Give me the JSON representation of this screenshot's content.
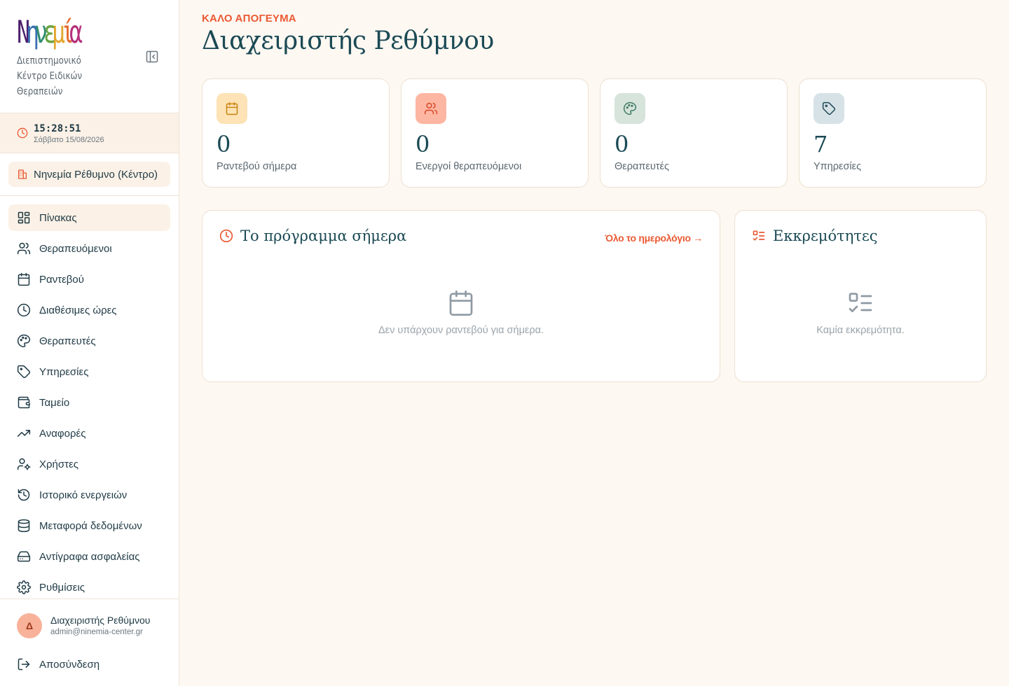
{
  "sidebar": {
    "brand_name": "Νηνεμία",
    "brand_letters": [
      "Ν",
      "η",
      "ν",
      "ε",
      "μ",
      "ί",
      "α"
    ],
    "brand_colors": [
      "#4d1f6d",
      "#3b6fb3",
      "#2f8d6f",
      "#6aa43f",
      "#e3a52b",
      "#e56b2f",
      "#b42f7a"
    ],
    "brand_subtitle": "Διεπιστημονικό Κέντρο Ειδικών Θεραπειών",
    "clock": {
      "time": "15:28:51",
      "date": "Σάββατο 15/08/2026"
    },
    "location": "Νηνεμία Ρέθυμνο (Κέντρο)",
    "nav": [
      {
        "label": "Πίνακας",
        "icon": "dashboard-icon"
      },
      {
        "label": "Θεραπευόμενοι",
        "icon": "users-icon"
      },
      {
        "label": "Ραντεβού",
        "icon": "calendar-icon"
      },
      {
        "label": "Διαθέσιμες ώρες",
        "icon": "clock-icon"
      },
      {
        "label": "Θεραπευτές",
        "icon": "palette-icon"
      },
      {
        "label": "Υπηρεσίες",
        "icon": "tag-icon"
      },
      {
        "label": "Ταμείο",
        "icon": "wallet-icon"
      },
      {
        "label": "Αναφορές",
        "icon": "trending-up-icon"
      },
      {
        "label": "Χρήστες",
        "icon": "user-cog-icon"
      },
      {
        "label": "Ιστορικό ενεργειών",
        "icon": "history-icon"
      },
      {
        "label": "Μεταφορά δεδομένων",
        "icon": "database-icon"
      },
      {
        "label": "Αντίγραφα ασφαλείας",
        "icon": "hard-drive-icon"
      },
      {
        "label": "Ρυθμίσεις",
        "icon": "gear-icon"
      }
    ],
    "active_index": 0,
    "user": {
      "initial": "Δ",
      "name": "Διαχειριστής Ρεθύμνου",
      "email": "admin@ninemia-center.gr"
    },
    "logout": "Αποσύνδεση"
  },
  "header": {
    "greeting": "ΚΑΛΟ ΑΠΟΓΕΥΜΑ",
    "title": "Διαχειριστής Ρεθύμνου"
  },
  "stats": [
    {
      "value": "0",
      "label": "Ραντεβού σήμερα",
      "icon": "calendar-icon",
      "bg": "#fde3b5",
      "fg": "#c98413"
    },
    {
      "value": "0",
      "label": "Ενεργοί θεραπευόμενοι",
      "icon": "users-icon",
      "bg": "#fdb6a2",
      "fg": "#d64a2a"
    },
    {
      "value": "0",
      "label": "Θεραπευτές",
      "icon": "palette-icon",
      "bg": "#d6e4dc",
      "fg": "#3f7a62"
    },
    {
      "value": "7",
      "label": "Υπηρεσίες",
      "icon": "tag-icon",
      "bg": "#d6e2e6",
      "fg": "#1f4a56"
    }
  ],
  "schedule": {
    "title": "Το πρόγραμμα σήμερα",
    "link": "Όλο το ημερολόγιο →",
    "empty": "Δεν υπάρχουν ραντεβού για σήμερα."
  },
  "pending": {
    "title": "Εκκρεμότητες",
    "empty": "Καμία εκκρεμότητα."
  },
  "colors": {
    "accent": "#ea5a34",
    "primary_text": "#1b4a55",
    "background": "#fdf8f2"
  }
}
